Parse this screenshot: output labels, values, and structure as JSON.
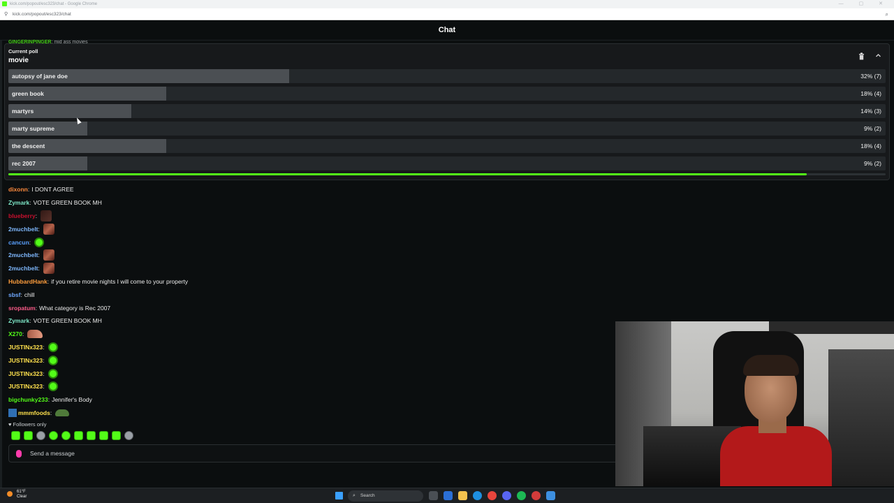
{
  "browser": {
    "window_title": "kick.com/popout/esc323/chat - Google Chrome",
    "url": "kick.com/popout/esc323/chat"
  },
  "chat": {
    "header_title": "Chat",
    "behind_poll_user": "GINGERINPINGER",
    "behind_poll_text": "mid ass movies"
  },
  "poll": {
    "label": "Current poll",
    "title": "movie",
    "options": [
      {
        "label": "autopsy of jane doe",
        "result": "32% (7)",
        "share": 0.32
      },
      {
        "label": "green book",
        "result": "18% (4)",
        "share": 0.18
      },
      {
        "label": "martyrs",
        "result": "14% (3)",
        "share": 0.14
      },
      {
        "label": "marty supreme",
        "result": "9% (2)",
        "share": 0.09
      },
      {
        "label": "the descent",
        "result": "18% (4)",
        "share": 0.18
      },
      {
        "label": "rec 2007",
        "result": "9% (2)",
        "share": 0.09
      }
    ],
    "time_remaining_fraction": 0.91
  },
  "messages": [
    {
      "user": "dixonn",
      "color": "#ff8a3d",
      "text": "I DONT AGREE",
      "emote": ""
    },
    {
      "user": "Zymark",
      "color": "#7ee8c8",
      "text": "VOTE GREEN BOOK MH",
      "emote": ""
    },
    {
      "user": "blueberry",
      "color": "#c8102e",
      "text": "",
      "emote": "face-dim"
    },
    {
      "user": "2muchbelt",
      "color": "#7fb8ff",
      "text": "",
      "emote": "face"
    },
    {
      "user": "cancun",
      "color": "#5aa0ff",
      "text": "",
      "emote": "kick"
    },
    {
      "user": "2muchbelt",
      "color": "#7fb8ff",
      "text": "",
      "emote": "face"
    },
    {
      "user": "2muchbelt",
      "color": "#7fb8ff",
      "text": "",
      "emote": "face"
    },
    {
      "user": "HubbardHank",
      "color": "#ff9e3d",
      "text": "if you retire movie nights I will come to your property",
      "emote": ""
    },
    {
      "user": "sbsf",
      "color": "#6fa8ff",
      "text": "chill",
      "emote": ""
    },
    {
      "user": "sropatum",
      "color": "#ff5c8a",
      "text": "What category is Rec 2007",
      "emote": ""
    },
    {
      "user": "Zymark",
      "color": "#7ee8c8",
      "text": "VOTE GREEN BOOK MH",
      "emote": ""
    },
    {
      "user": "X270",
      "color": "#53fc18",
      "text": "",
      "emote": "hand"
    },
    {
      "user": "JUSTINx323",
      "color": "#ffe14d",
      "text": "",
      "emote": "kick"
    },
    {
      "user": "JUSTINx323",
      "color": "#ffe14d",
      "text": "",
      "emote": "kick"
    },
    {
      "user": "JUSTINx323",
      "color": "#ffe14d",
      "text": "",
      "emote": "kick"
    },
    {
      "user": "JUSTINx323",
      "color": "#ffe14d",
      "text": "",
      "emote": "kick"
    },
    {
      "user": "bigchunky233",
      "color": "#53fc18",
      "text": "Jennifer's Body",
      "emote": ""
    },
    {
      "user": "mmmfoods",
      "color": "#ffe14d",
      "text": "",
      "emote": "pepe",
      "badge": true
    }
  ],
  "followers_label": "♥ Followers only",
  "input": {
    "placeholder": "Send a message"
  },
  "taskbar": {
    "weather_temp": "61°F",
    "weather_desc": "Clear",
    "search_placeholder": "Search"
  },
  "colors": {
    "accent": "#53fc18",
    "background": "#0b0e0f"
  }
}
